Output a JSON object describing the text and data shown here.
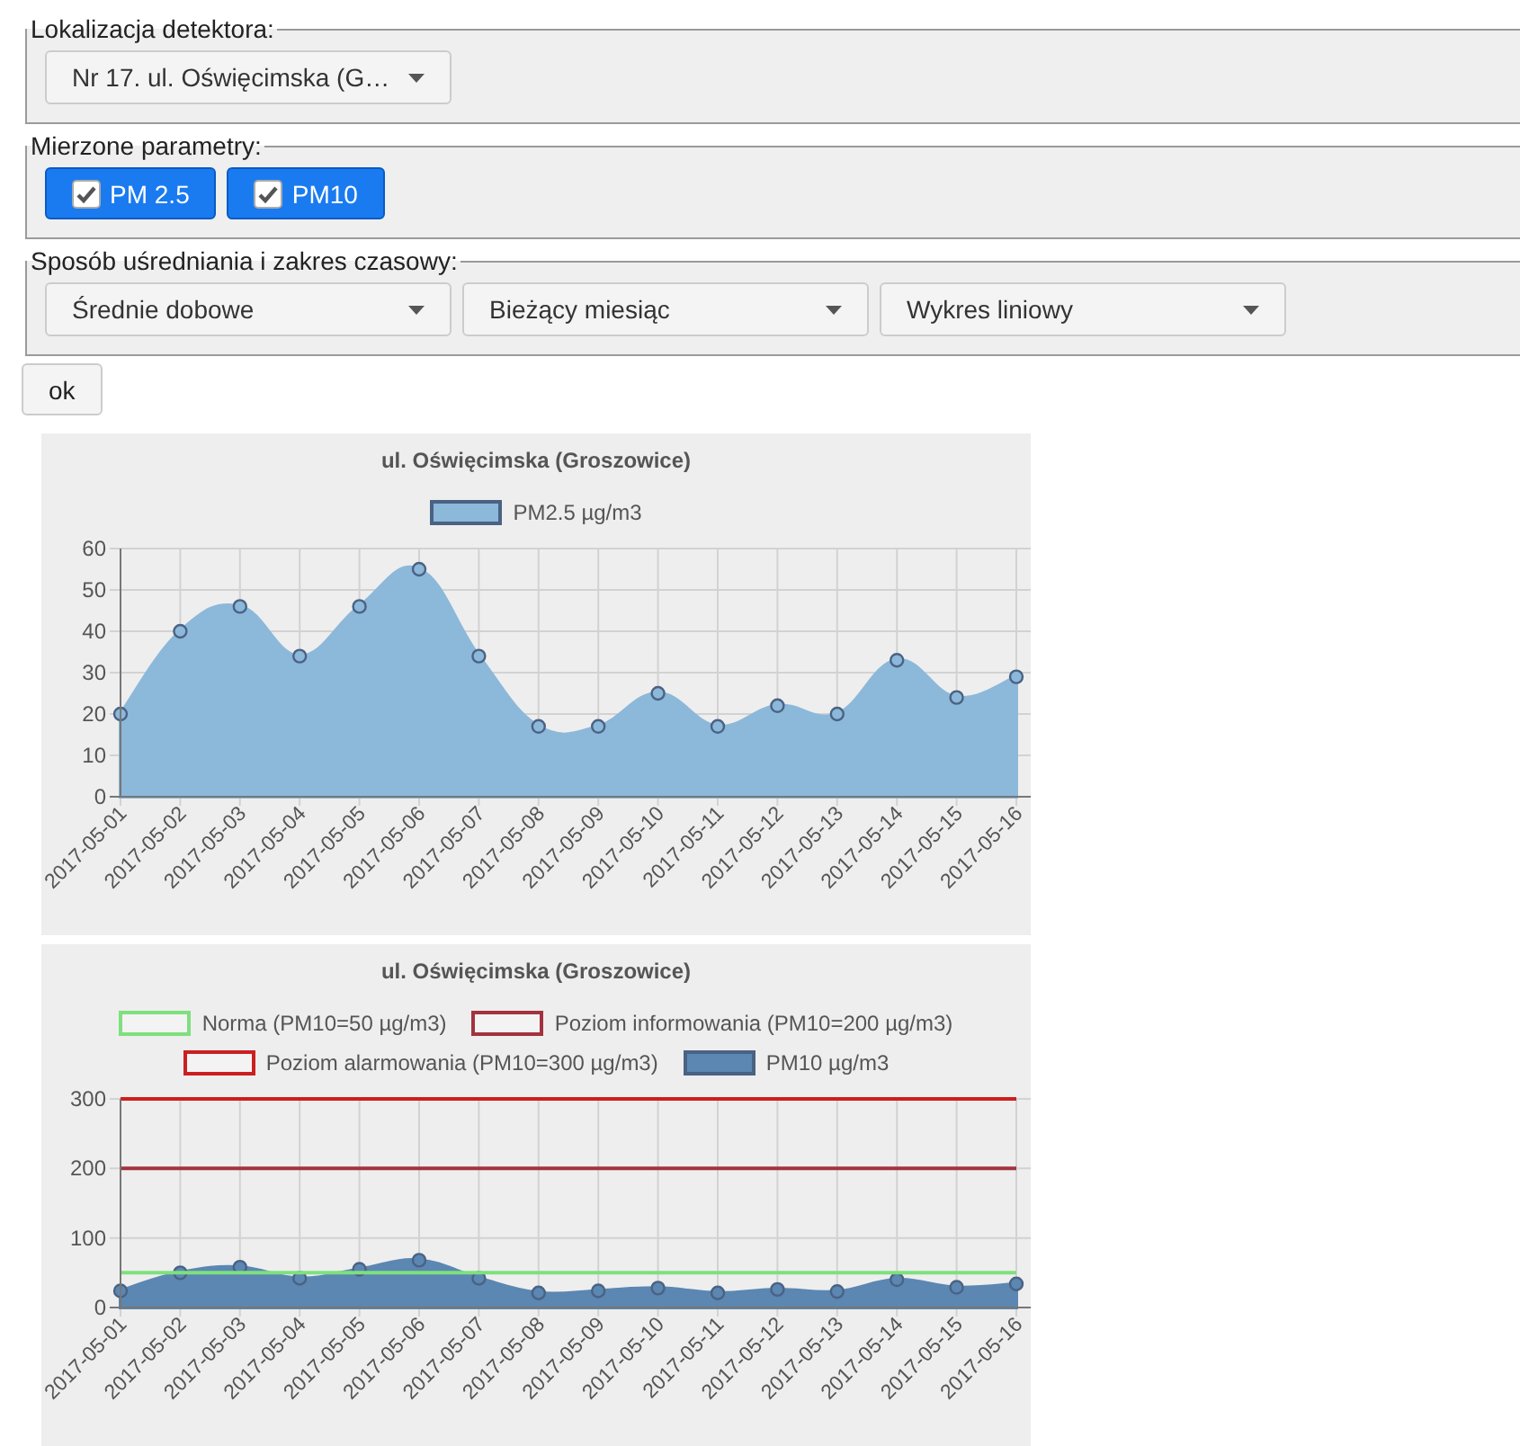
{
  "filters": [
    {
      "legend": "Lokalizacja detektora:",
      "controls": [
        {
          "kind": "select",
          "value": "Nr 17. ul. Oświęcimska (G…"
        }
      ]
    },
    {
      "legend": "Mierzone parametry:",
      "controls": [
        {
          "kind": "toggle",
          "label": "PM 2.5",
          "checked": true
        },
        {
          "kind": "toggle",
          "label": "PM10",
          "checked": true
        }
      ]
    },
    {
      "legend": "Sposób uśredniania i zakres czasowy:",
      "controls": [
        {
          "kind": "select",
          "value": "Średnie dobowe"
        },
        {
          "kind": "select",
          "value": "Bieżący miesiąc"
        },
        {
          "kind": "select",
          "value": "Wykres liniowy"
        }
      ]
    }
  ],
  "submit": {
    "label": "ok"
  },
  "charts": [
    {
      "chart_data": {
        "type": "area",
        "title": "ul. Oświęcimska (Groszowice)",
        "legend": "top",
        "grid": true,
        "categories": [
          "2017-05-01",
          "2017-05-02",
          "2017-05-03",
          "2017-05-04",
          "2017-05-05",
          "2017-05-06",
          "2017-05-07",
          "2017-05-08",
          "2017-05-09",
          "2017-05-10",
          "2017-05-11",
          "2017-05-12",
          "2017-05-13",
          "2017-05-14",
          "2017-05-15",
          "2017-05-16"
        ],
        "ylim": [
          0,
          60
        ],
        "yticks": [
          0,
          10,
          20,
          30,
          40,
          50,
          60
        ],
        "series": [
          {
            "name": "PM2.5 µg/m3",
            "color": "#8cb8da",
            "values": [
              20,
              40,
              46,
              34,
              46,
              55,
              34,
              17,
              17,
              25,
              17,
              22,
              20,
              33,
              24,
              29
            ]
          }
        ]
      }
    },
    {
      "chart_data": {
        "type": "area",
        "title": "ul. Oświęcimska (Groszowice)",
        "legend": "top",
        "grid": true,
        "categories": [
          "2017-05-01",
          "2017-05-02",
          "2017-05-03",
          "2017-05-04",
          "2017-05-05",
          "2017-05-06",
          "2017-05-07",
          "2017-05-08",
          "2017-05-09",
          "2017-05-10",
          "2017-05-11",
          "2017-05-12",
          "2017-05-13",
          "2017-05-14",
          "2017-05-15",
          "2017-05-16"
        ],
        "ylim": [
          0,
          300
        ],
        "yticks": [
          0,
          100,
          200,
          300
        ],
        "ref_lines": [
          {
            "axis": "y",
            "value": 50,
            "label": "Norma (PM10=50 µg/m3)",
            "color": "#7ee07e"
          },
          {
            "axis": "y",
            "value": 200,
            "label": "Poziom informowania (PM10=200 µg/m3)",
            "color": "#a3323f"
          },
          {
            "axis": "y",
            "value": 300,
            "label": "Poziom alarmowania (PM10=300 µg/m3)",
            "color": "#cc1f1f"
          }
        ],
        "series": [
          {
            "name": "PM10 µg/m3",
            "color": "#5b87b2",
            "values": [
              24,
              50,
              58,
              42,
              55,
              68,
              42,
              21,
              24,
              28,
              21,
              26,
              23,
              40,
              29,
              34
            ]
          }
        ]
      }
    }
  ]
}
